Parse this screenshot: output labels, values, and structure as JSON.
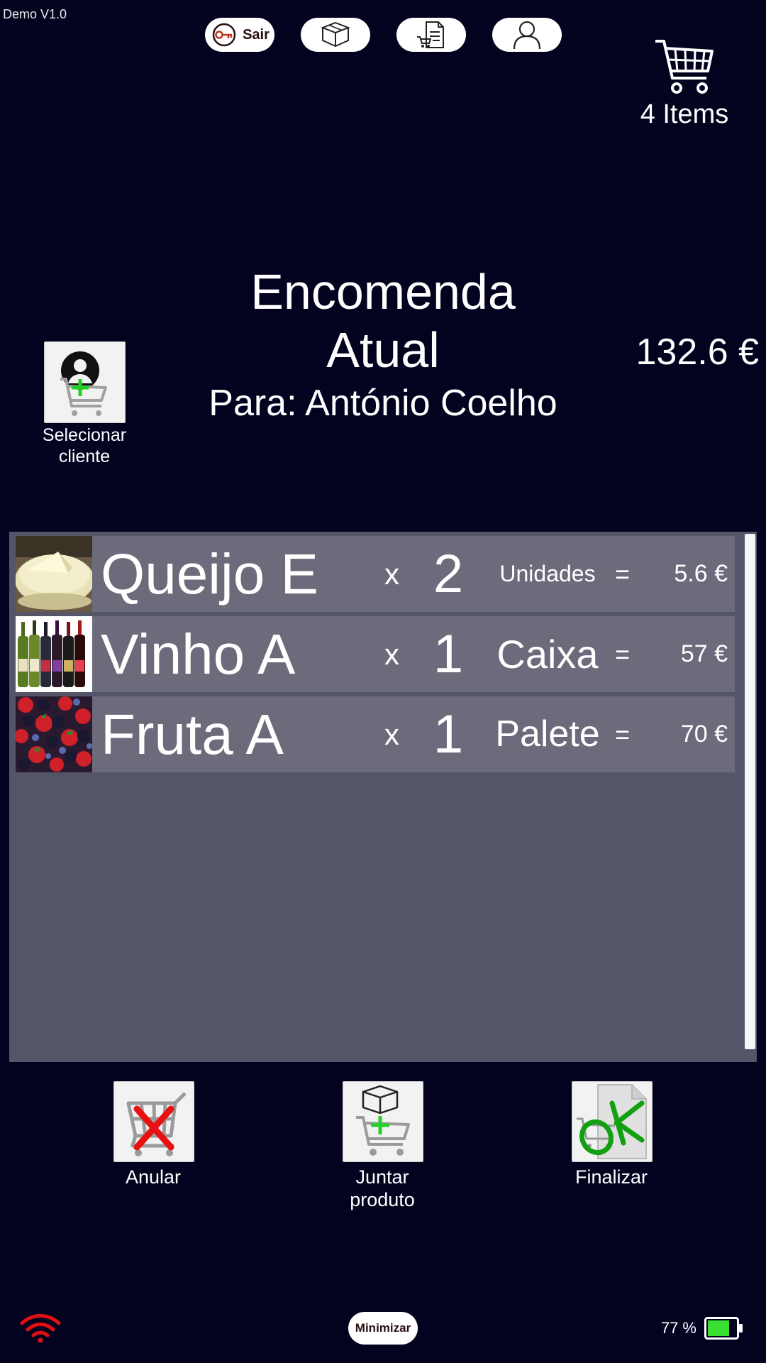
{
  "app": {
    "version": "Demo V1.0"
  },
  "topbar": {
    "exit_label": "Sair",
    "cart_count_label": "4 Items"
  },
  "order": {
    "title_line1": "Encomenda",
    "title_line2": "Atual",
    "customer_label": "Para: António Coelho",
    "total": "132.6 €",
    "select_client_line1": "Selecionar",
    "select_client_line2": "cliente"
  },
  "items": [
    {
      "name": "Queijo E",
      "times": "x",
      "qty": "2",
      "unit": "Unidades",
      "eq": "=",
      "price": "5.6 €"
    },
    {
      "name": "Vinho A",
      "times": "x",
      "qty": "1",
      "unit": "Caixa",
      "eq": "=",
      "price": "57 €"
    },
    {
      "name": "Fruta A",
      "times": "x",
      "qty": "1",
      "unit": "Palete",
      "eq": "=",
      "price": "70 €"
    }
  ],
  "actions": {
    "cancel_label": "Anular",
    "add_product_line1": "Juntar",
    "add_product_line2": "produto",
    "finish_label": "Finalizar"
  },
  "footer": {
    "minimize_label": "Minimizar",
    "battery_percent": "77 %",
    "battery_level": 0.77
  },
  "colors": {
    "background": "#03031f",
    "list_panel": "#555569",
    "row": "#6b6b7b",
    "wifi": "#e01010",
    "battery_fill": "#3ae030"
  }
}
